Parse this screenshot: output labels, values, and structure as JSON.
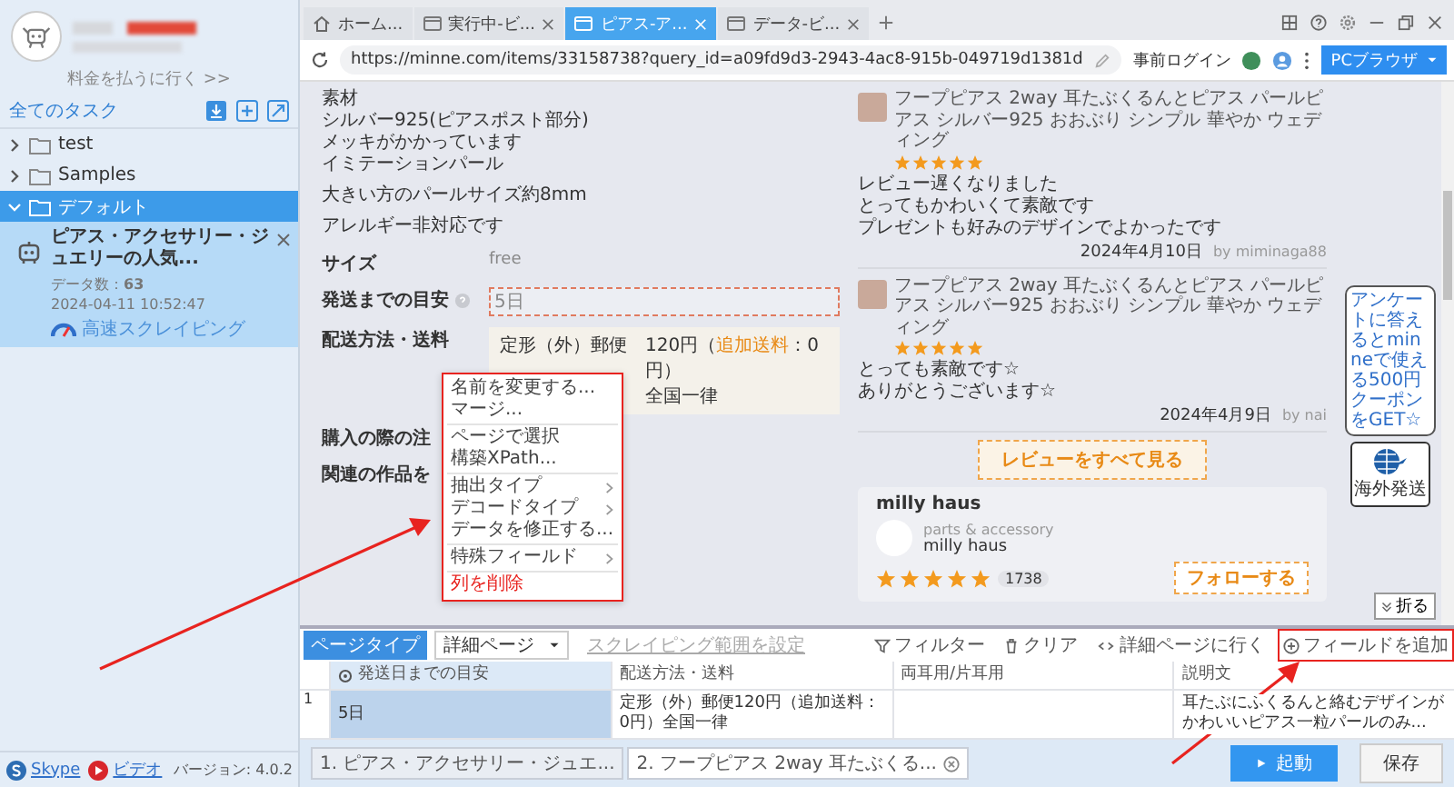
{
  "sidebar": {
    "pay_link": "料金を払うに行く >>",
    "section_title": "全てのタスク",
    "tree": [
      {
        "label": "test",
        "expanded": false,
        "selected": false
      },
      {
        "label": "Samples",
        "expanded": false,
        "selected": false
      },
      {
        "label": "デフォルト",
        "expanded": true,
        "selected": true,
        "children": [
          {
            "title": "ピアス・アクセサリー・ジュエリーの人気...",
            "count_label": "データ数：",
            "count": "63",
            "date": "2024-04-11 10:52:47",
            "mode": "高速スクレイピング",
            "selected": true
          }
        ]
      }
    ],
    "footer": {
      "links": [
        {
          "label": "Skype",
          "kind": "skype"
        },
        {
          "label": "ビデオ",
          "kind": "video"
        }
      ],
      "version": "バージョン: 4.0.2"
    }
  },
  "browser": {
    "tabs": [
      {
        "label": "ホーム...",
        "kind": "home",
        "selected": false
      },
      {
        "label": "実行中-ビ...",
        "kind": "page",
        "selected": false
      },
      {
        "label": "ピアス-ア...",
        "kind": "page",
        "selected": true
      },
      {
        "label": "データ-ビ...",
        "kind": "page",
        "selected": false
      }
    ],
    "url": "https://minne.com/items/33158738?query_id=a09fd9d3-2943-4ac8-915b-049719d1381d",
    "login_label": "事前ログイン",
    "mode_button": "PCブラウザ"
  },
  "page": {
    "material": [
      [
        "素材",
        "シルバー925(ピアスポスト部分)",
        "メッキがかかっています",
        "イミテーションパール"
      ],
      [
        "大きい方のパールサイズ約8mm"
      ],
      [
        "アレルギー非対応です"
      ]
    ],
    "specs": [
      {
        "kind": "plain",
        "label": "サイズ",
        "value": "free"
      },
      {
        "kind": "field",
        "label": "発送までの目安",
        "help_icon": true,
        "value": "5日"
      },
      {
        "kind": "shipping",
        "label": "配送方法・送料",
        "method": "定形（外）郵便",
        "price_before": "120円（",
        "extra_link": "追加送料",
        "price_after": "：0円）",
        "region": "全国一律"
      },
      {
        "kind": "heading",
        "label": "購入の際の注"
      },
      {
        "kind": "heading",
        "label": "関連の作品を"
      }
    ],
    "reviews": [
      {
        "product": "フープピアス 2way 耳たぶくるんとピアス パールピアス シルバー925 おおぶり シンプル 華やか ウェディング",
        "stars": 5,
        "lines": [
          "レビュー遅くなりました",
          "とってもかわいくて素敵です",
          "プレゼントも好みのデザインでよかったです"
        ],
        "date": "2024年4月10日",
        "author": "by miminaga88"
      },
      {
        "product": "フープピアス 2way 耳たぶくるんとピアス パールピアス シルバー925 おおぶり シンプル 華やか ウェディング",
        "stars": 5,
        "lines": [
          "とっても素敵です☆",
          "ありがとうございます☆"
        ],
        "date": "2024年4月9日",
        "author": "by nai"
      }
    ],
    "all_reviews_button": "レビューをすべて見る",
    "shop": {
      "name": "milly haus",
      "category": "parts & accessory",
      "shop_name": "milly haus",
      "stars": 5,
      "rating_count": "1738",
      "follow_button": "フォローする"
    },
    "collapse_button": "折る",
    "survey_bubble": "アンケートに答えるとminneで使える500円クーポンをGET☆",
    "overseas_label": "海外発送"
  },
  "context_menu": {
    "groups": [
      [
        {
          "label": "名前を変更する...",
          "kind": "action"
        },
        {
          "label": "マージ...",
          "kind": "action"
        }
      ],
      [
        {
          "label": "ページで選択",
          "kind": "action"
        },
        {
          "label": "構築XPath...",
          "kind": "action"
        }
      ],
      [
        {
          "label": "抽出タイプ",
          "kind": "submenu"
        },
        {
          "label": "デコードタイプ",
          "kind": "submenu"
        },
        {
          "label": "データを修正する...",
          "kind": "action"
        }
      ],
      [
        {
          "label": "特殊フィールド",
          "kind": "submenu"
        }
      ],
      [
        {
          "label": "列を削除",
          "kind": "danger"
        }
      ]
    ]
  },
  "data_panel": {
    "page_type_label": "ページタイプ",
    "page_type_value": "詳細ページ",
    "range_link": "スクレイピング範囲を設定",
    "actions": [
      {
        "label": "フィルター",
        "kind": "filter",
        "highlighted": false
      },
      {
        "label": "クリア",
        "kind": "clear",
        "highlighted": false
      },
      {
        "label": "詳細ページに行く",
        "kind": "goto",
        "highlighted": false
      },
      {
        "label": "フィールドを追加",
        "kind": "add",
        "highlighted": true
      }
    ],
    "columns": [
      {
        "label": "発送日までの目安",
        "selected": true
      },
      {
        "label": "配送方法・送料",
        "selected": false
      },
      {
        "label": "両耳用/片耳用",
        "selected": false
      },
      {
        "label": "説明文",
        "selected": false
      }
    ],
    "rows": [
      {
        "index": "1",
        "cells": [
          "5日",
          "定形（外）郵便120円（追加送料：0円）全国一律",
          null,
          "耳たぶにふくるんと絡むデザインがかわいいピアス一粒パールのみ..."
        ]
      }
    ]
  },
  "bottom_bar": {
    "tabs": [
      {
        "label": "1. ピアス・アクセサリー・ジュエ...",
        "selected": false
      },
      {
        "label": "2. フープピアス 2way 耳たぶくる...",
        "selected": true
      }
    ],
    "run_button": "起動",
    "save_button": "保存"
  }
}
